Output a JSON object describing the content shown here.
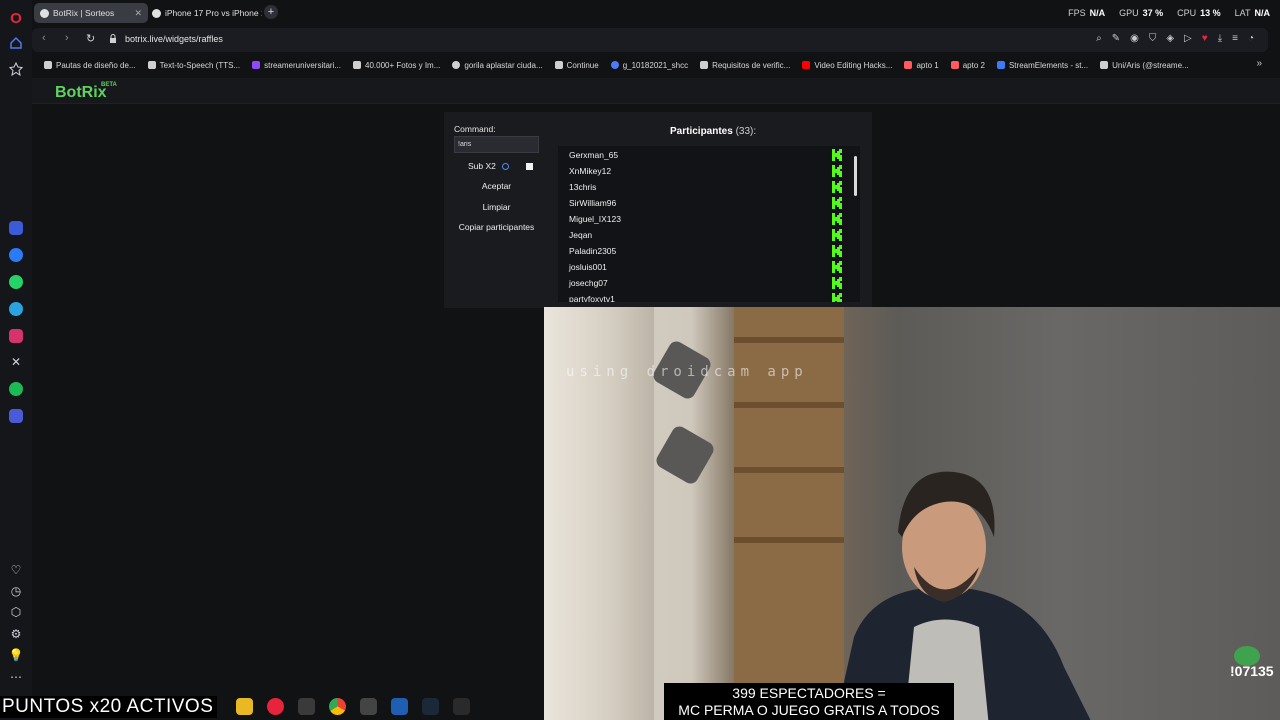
{
  "tabs": [
    {
      "label": "BotRix | Sorteos",
      "active": true
    },
    {
      "label": "iPhone 17 Pro vs iPhone 1",
      "active": false
    }
  ],
  "stats": {
    "fps_label": "FPS",
    "fps_value": "N/A",
    "gpu_label": "GPU",
    "gpu_value": "37 %",
    "cpu_label": "CPU",
    "cpu_value": "13 %",
    "lat_label": "LAT",
    "lat_value": "N/A"
  },
  "address": {
    "url": "botrix.live/widgets/raffles"
  },
  "bookmarks": [
    "Pautas de diseño de...",
    "Text-to-Speech (TTS...",
    "streameruniversitari...",
    "40.000+ Fotos y Im...",
    "gorila aplastar ciuda...",
    "Continue",
    "g_10182021_shcc",
    "Requisitos de verific...",
    "Video Editing Hacks...",
    "apto 1",
    "apto 2",
    "StreamElements - st...",
    "Uni/Aris (@streame..."
  ],
  "app": {
    "logo": "BotRix",
    "beta": "BETA"
  },
  "raffle": {
    "command_label": "Command:",
    "command_value": "!aris",
    "sub_label": "Sub X2",
    "accept_label": "Aceptar",
    "clear_label": "Limpiar",
    "copy_label": "Copiar participantes",
    "participants_title": "Participantes",
    "participants_count": "(33):",
    "participants": [
      "Gerxman_65",
      "XnMikey12",
      "13chris",
      "SirWilliam96",
      "Miguel_IX123",
      "Jeqan",
      "Paladin2305",
      "josluis001",
      "josechg07",
      "partyfoxytv1"
    ]
  },
  "overlay": {
    "watermark": "using droidcam app",
    "viewers_line1": "399 ESPECTADORES =",
    "viewers_line2": "MC PERMA O JUEGO GRATIS A TODOS",
    "points": "PUNTOS x20 ACTIVOS",
    "sub_count": "!07135"
  },
  "colors": {
    "accent_green": "#5fd35f",
    "kick_green": "#53fc18",
    "opera_red": "#e8243c"
  },
  "taskbar": [
    "opera-icon",
    "lista-icon",
    "chrome-icon",
    "window-icon",
    "vscode-icon",
    "steam-icon",
    "epic-icon"
  ]
}
